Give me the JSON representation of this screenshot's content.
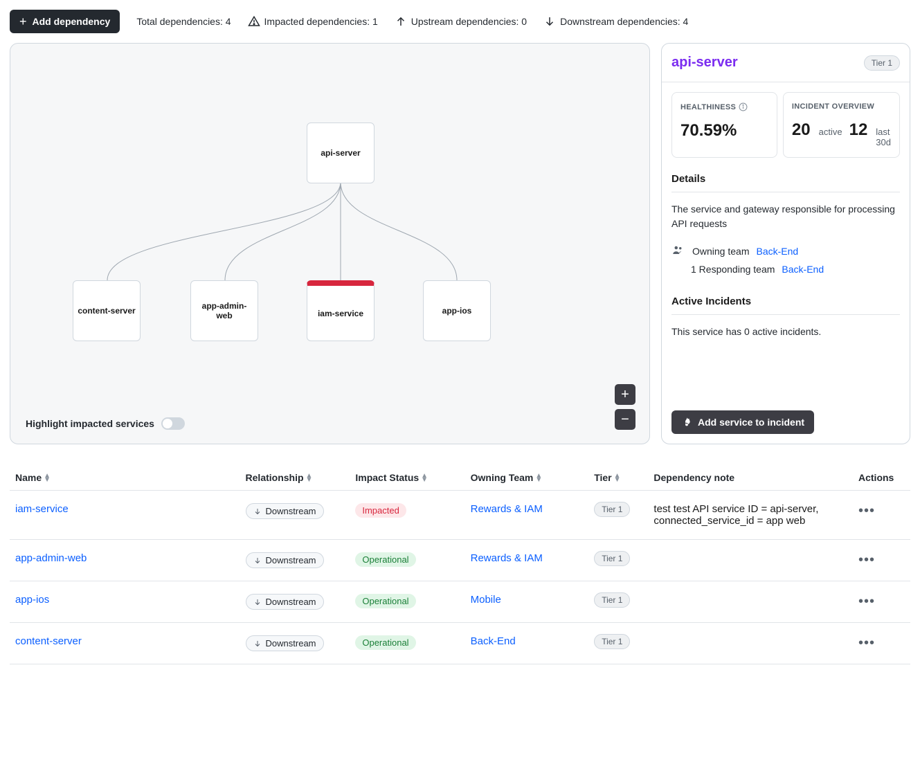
{
  "topbar": {
    "add_dependency_label": "Add dependency",
    "total_label": "Total dependencies: 4",
    "impacted_label": "Impacted dependencies: 1",
    "upstream_label": "Upstream dependencies: 0",
    "downstream_label": "Downstream dependencies: 4"
  },
  "graph": {
    "highlight_label": "Highlight impacted services",
    "nodes": {
      "root": "api-server",
      "a": "content-server",
      "b": "app-admin-web",
      "c": "iam-service",
      "d": "app-ios"
    }
  },
  "side": {
    "title": "api-server",
    "tier": "Tier 1",
    "health_label": "HEALTHINESS",
    "health_value": "70.59%",
    "incident_label": "INCIDENT OVERVIEW",
    "incident_active_num": "20",
    "incident_active_lbl": "active",
    "incident_last_num": "12",
    "incident_last_lbl": "last 30d",
    "details_heading": "Details",
    "description": "The service and gateway responsible for processing API requests",
    "owning_team_label": "Owning team",
    "owning_team_value": "Back-End",
    "responding_label": "1 Responding team",
    "responding_value": "Back-End",
    "active_heading": "Active Incidents",
    "active_text": "This service has 0 active incidents.",
    "add_incident_label": "Add service to incident"
  },
  "table": {
    "headers": {
      "name": "Name",
      "relationship": "Relationship",
      "impact": "Impact Status",
      "team": "Owning Team",
      "tier": "Tier",
      "note": "Dependency note",
      "actions": "Actions"
    },
    "rows": [
      {
        "name": "iam-service",
        "relationship": "Downstream",
        "impact": "Impacted",
        "impact_class": "impacted",
        "team": "Rewards & IAM",
        "tier": "Tier 1",
        "note": "test test API service ID = api-server, connected_service_id = app web"
      },
      {
        "name": "app-admin-web",
        "relationship": "Downstream",
        "impact": "Operational",
        "impact_class": "operational",
        "team": "Rewards & IAM",
        "tier": "Tier 1",
        "note": ""
      },
      {
        "name": "app-ios",
        "relationship": "Downstream",
        "impact": "Operational",
        "impact_class": "operational",
        "team": "Mobile",
        "tier": "Tier 1",
        "note": ""
      },
      {
        "name": "content-server",
        "relationship": "Downstream",
        "impact": "Operational",
        "impact_class": "operational",
        "team": "Back-End",
        "tier": "Tier 1",
        "note": ""
      }
    ]
  }
}
